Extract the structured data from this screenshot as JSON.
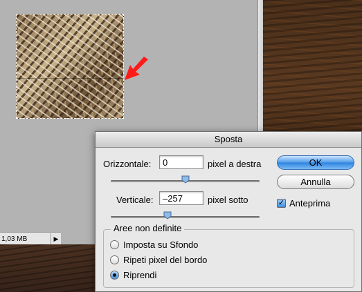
{
  "document": {
    "file_size": "1,03 MB",
    "menu_arrow_icon": "triangle-right"
  },
  "dialog": {
    "title": "Sposta",
    "horizontal": {
      "label": "Orizzontale:",
      "value": "0",
      "unit": "pixel a destra",
      "slider_position": 0.5
    },
    "vertical": {
      "label": "Verticale:",
      "value": "–257",
      "unit": "pixel sotto",
      "slider_position": 0.38
    },
    "buttons": {
      "ok": "OK",
      "cancel": "Annulla"
    },
    "preview": {
      "label": "Anteprima",
      "checked": true
    },
    "undefined_areas": {
      "title": "Aree non definite",
      "options": [
        {
          "label": "Imposta su Sfondo",
          "selected": false
        },
        {
          "label": "Ripeti pixel del bordo",
          "selected": false
        },
        {
          "label": "Riprendi",
          "selected": true
        }
      ]
    }
  },
  "colors": {
    "annotation_arrow": "#ff1a1a",
    "ok_button": "#2d83e0"
  }
}
